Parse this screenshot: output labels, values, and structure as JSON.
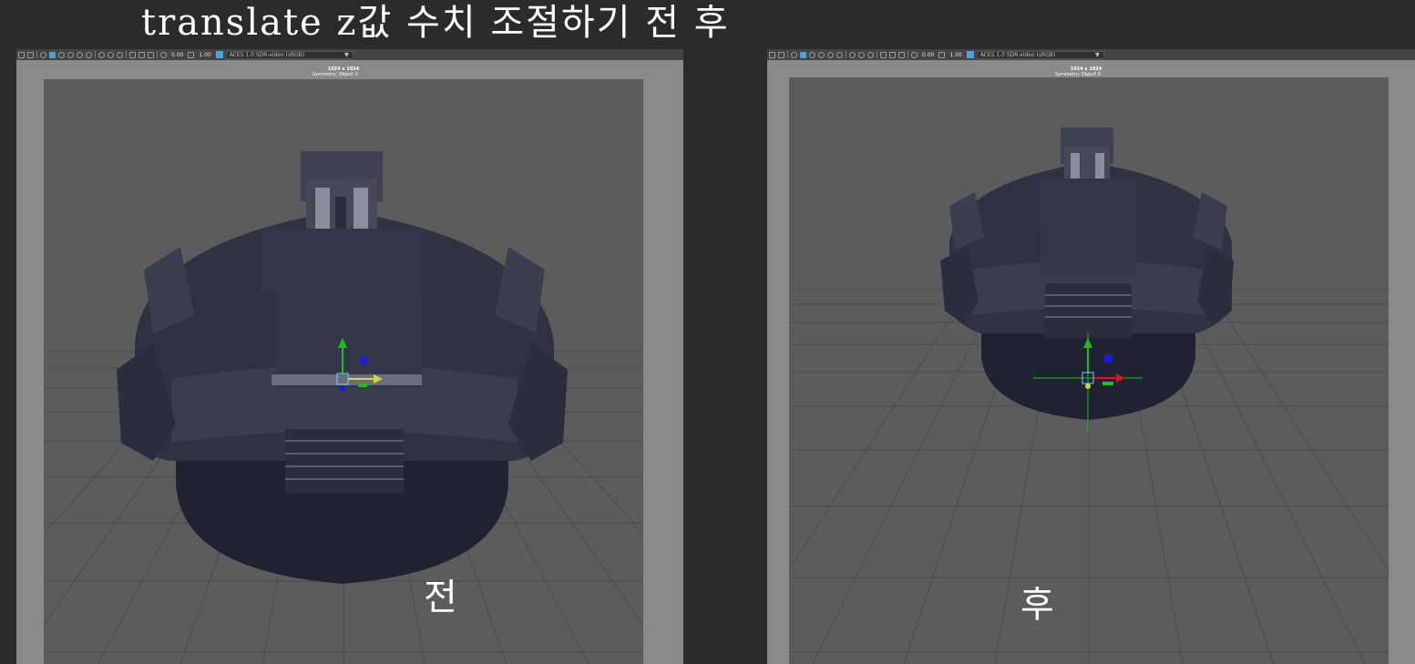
{
  "title": "translate z값 수치 조절하기 전 후",
  "panels": {
    "before": {
      "caption": "전",
      "resolution": "1024 x 1024",
      "symmetry": "Symmetry: Object X",
      "toolbar": {
        "value1": "0.00",
        "value2": "1.00",
        "color_space": "ACES 1.0 SDR-video (sRGB)"
      }
    },
    "after": {
      "caption": "후",
      "resolution": "1024 x 1024",
      "symmetry": "Symmetry: Object X",
      "toolbar": {
        "value1": "0.00",
        "value2": "1.00",
        "color_space": "ACES 1.0 SDR-video (sRGB)"
      }
    }
  },
  "icons": [
    "camera-icon",
    "grid-icon",
    "shading-icon",
    "light-icon",
    "isolate-icon",
    "xray-icon",
    "gamma-icon",
    "colorspace-icon"
  ],
  "colors": {
    "background": "#2b2b2b",
    "viewport": "#5a5a5a",
    "gate_mask": "#8a8a8a",
    "model": "#2e3140",
    "manipulator_y": "#19c219",
    "manipulator_x": "#d6d630",
    "manipulator_z": "#1a1ad8",
    "accent": "#4aa3d8"
  }
}
